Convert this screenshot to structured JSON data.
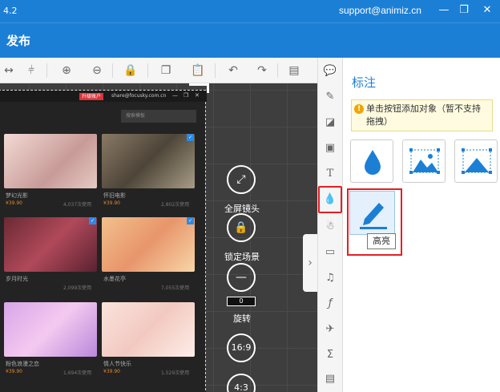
{
  "app": {
    "version": "4.2",
    "email": "support@animiz.cn",
    "publish": "发布"
  },
  "window": {
    "minimize": "—",
    "restore": "❐",
    "close": "✕"
  },
  "toolbar": {
    "items": [
      "↔",
      "⊕",
      "⊖",
      "🔒",
      "❐",
      "📋",
      "↶",
      "↷",
      "▤"
    ]
  },
  "scene": {
    "badge": "升级账户",
    "mail": "share@focusky.com.cn",
    "search": "搜索模板",
    "cards": [
      {
        "title": "梦幻光影",
        "price": "¥39.90",
        "uses": "4,037次使用"
      },
      {
        "title": "怀旧电影",
        "price": "¥39.90",
        "uses": "2,802次使用"
      },
      {
        "title": "岁月时光",
        "price": "",
        "uses": "2,099次使用"
      },
      {
        "title": "水墨花亭",
        "price": "",
        "uses": "7,055次使用"
      },
      {
        "title": "粉色浪漫之恋",
        "price": "¥39.90",
        "uses": "1,694次使用"
      },
      {
        "title": "情人节快乐",
        "price": "¥39.90",
        "uses": "1,529次使用"
      }
    ]
  },
  "controls": {
    "fullscreen": "全屏镜头",
    "lock": "锁定场景",
    "rotate_value": "0",
    "rotate": "旋转",
    "ratio169": "16:9",
    "ratio43": "4:3"
  },
  "panel": {
    "title": "标注",
    "tip": "单击按钮添加对象（暂不支持拖拽）",
    "tooltip": "高亮"
  },
  "colors": {
    "brand": "#1c7fd6",
    "highlight": "#e41f24"
  }
}
